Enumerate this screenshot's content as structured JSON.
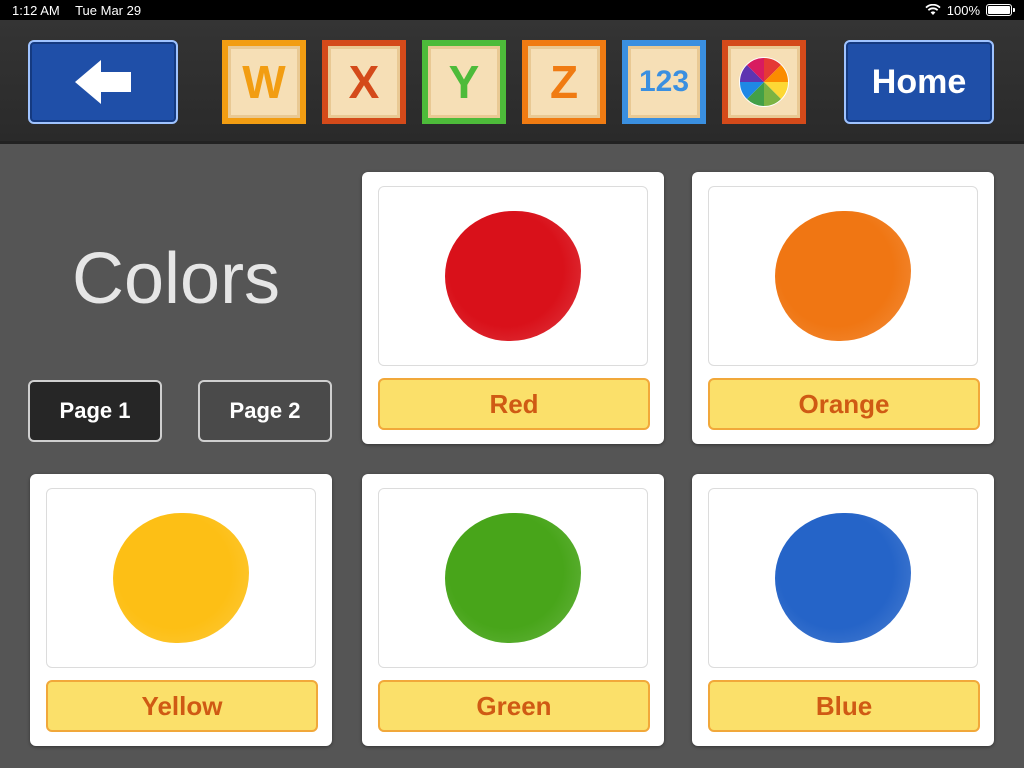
{
  "status": {
    "time": "1:12 AM",
    "date": "Tue Mar 29",
    "battery": "100%"
  },
  "toolbar": {
    "back_icon": "left-arrow-icon",
    "tiles": [
      "W",
      "X",
      "Y",
      "Z",
      "123"
    ],
    "colors_icon": "color-wheel-icon",
    "home_label": "Home"
  },
  "main": {
    "title": "Colors",
    "pages": [
      "Page 1",
      "Page 2"
    ],
    "cards": [
      {
        "label": "Red",
        "color": "#d9111a"
      },
      {
        "label": "Orange",
        "color": "#f07613"
      },
      {
        "label": "Yellow",
        "color": "#fdbf15"
      },
      {
        "label": "Green",
        "color": "#48a51a"
      },
      {
        "label": "Blue",
        "color": "#2564c8"
      }
    ]
  },
  "colors": {
    "toolbar_blue": "#1f4fa8",
    "label_bg": "#fbe06a",
    "label_text": "#cf5a14"
  }
}
